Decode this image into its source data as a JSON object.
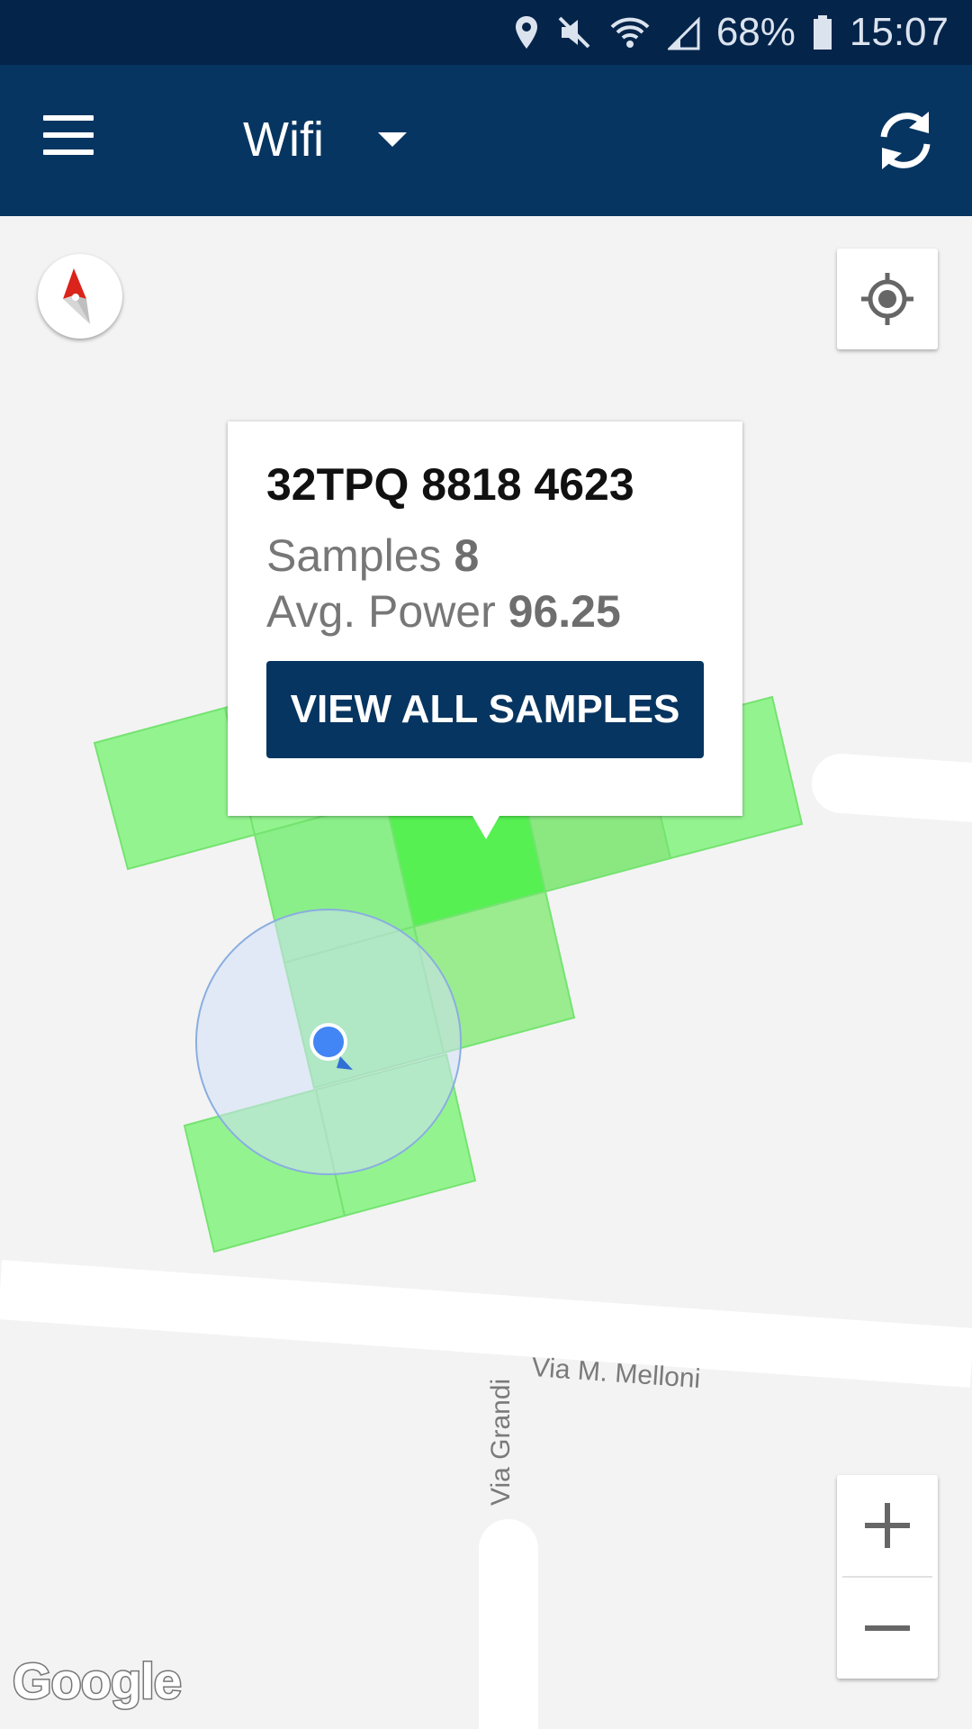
{
  "status_bar": {
    "battery": "68%",
    "time": "15:07",
    "icons": [
      "location-icon",
      "mute-icon",
      "wifi-icon",
      "signal-icon",
      "battery-icon"
    ]
  },
  "app_bar": {
    "layer_selected": "Wifi",
    "icons": [
      "menu-icon",
      "dropdown-caret-icon",
      "refresh-icon"
    ]
  },
  "map": {
    "streets": [
      "Via M. Melloni",
      "Via Grandi"
    ],
    "attribution": "Google",
    "controls": [
      "compass-icon",
      "my-location-icon",
      "zoom-in-icon",
      "zoom-out-icon"
    ]
  },
  "popup": {
    "cell_id": "32TPQ 8818 4623",
    "samples_label": "Samples",
    "samples_value": "8",
    "power_label": "Avg. Power",
    "power_value": "96.25",
    "button_label": "VIEW ALL SAMPLES"
  },
  "colors": {
    "status_bar": "#04244a",
    "app_bar": "#073561",
    "button": "#073561",
    "tile_light": "#8ef58a",
    "tile_strong": "#4ef04a",
    "location_dot": "#4285f4"
  }
}
